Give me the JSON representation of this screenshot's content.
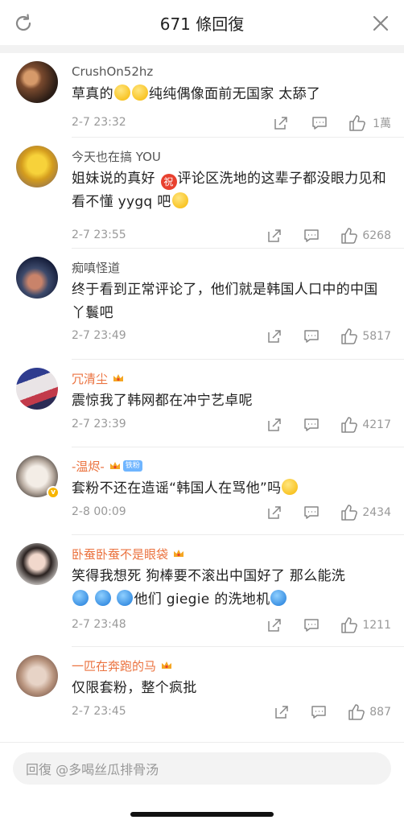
{
  "header": {
    "title": "671 條回復"
  },
  "comments": [
    {
      "name": "CrushOn52hz",
      "text_pre": "草真的",
      "text_post": "纯纯偶像面前无国家 太舔了",
      "time": "2-7 23:32",
      "likes": "1萬"
    },
    {
      "name": "今天也在搞 YOU",
      "text_pre": "姐妹说的真好 ",
      "text_post": "评论区洗地的这辈子都没眼力见和看不懂 yygq 吧",
      "time": "2-7 23:55",
      "likes": "6268"
    },
    {
      "name": "痴嗔怪道",
      "text": "终于看到正常评论了，他们就是韩国人口中的中国丫鬟吧",
      "time": "2-7 23:49",
      "likes": "5817"
    },
    {
      "name": "冗清尘",
      "text": "震惊我了韩网都在冲宁艺卓呢",
      "time": "2-7 23:39",
      "likes": "4217"
    },
    {
      "name": "-温烬-",
      "fan_badge": "铁粉",
      "text": "套粉不还在造谣“韩国人在骂他”吗",
      "time": "2-8 00:09",
      "likes": "2434"
    },
    {
      "name": "卧蚕卧蚕不是眼袋",
      "text_pre": "笑得我想死 狗棒要不滚出中国好了 那么能洗",
      "text_post": "他们 giegie 的洗地机",
      "time": "2-7 23:48",
      "likes": "1211"
    },
    {
      "name": "一匹在奔跑的马",
      "text": "仅限套粉，整个疯批",
      "time": "2-7 23:45",
      "likes": "887"
    }
  ],
  "reply": {
    "placeholder": "回復 @多喝丝瓜排骨汤"
  },
  "icons": {
    "refresh": "refresh-icon",
    "close": "close-icon",
    "share": "share-icon",
    "comment": "comment-icon",
    "like": "like-icon",
    "crown": "crown-icon"
  },
  "colors": {
    "orange_name": "#eb7340",
    "gray_text": "#999999",
    "fan_badge": "#6fb5ff"
  }
}
